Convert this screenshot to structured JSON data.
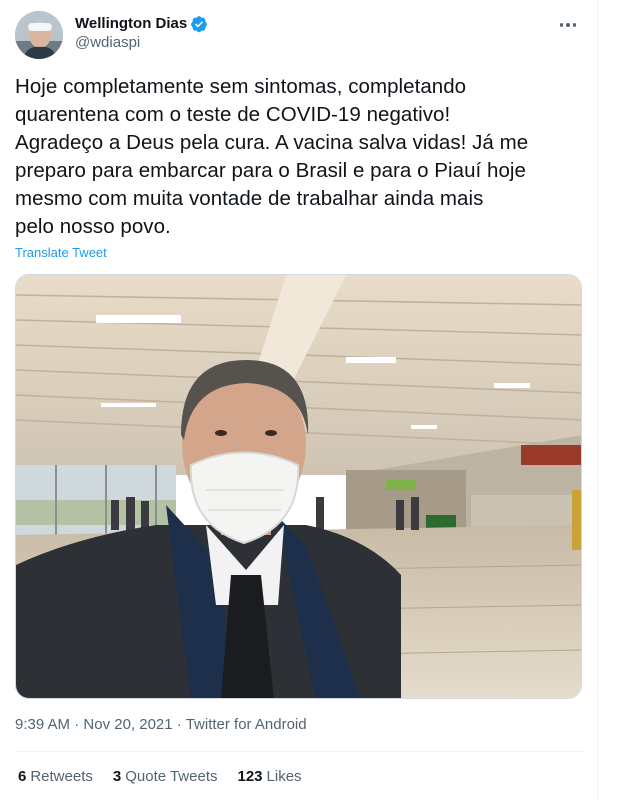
{
  "author": {
    "display_name": "Wellington Dias",
    "handle": "@wdiaspi",
    "verified": true
  },
  "tweet": {
    "text": "Hoje completamente sem sintomas, completando\nquarentena com o teste de COVID-19 negativo!\nAgradeço a Deus pela cura. A vacina salva vidas! Já me\npreparo para embarcar para o Brasil e para o Piauí hoje\nmesmo com muita vontade de trabalhar ainda mais\npelo nosso povo.",
    "translate_label": "Translate Tweet",
    "time": "9:39 AM",
    "separator": "·",
    "date": "Nov 20, 2021",
    "source": "Twitter for Android"
  },
  "stats": {
    "retweets_count": "6",
    "retweets_label": "Retweets",
    "quotes_count": "3",
    "quotes_label": "Quote Tweets",
    "likes_count": "123",
    "likes_label": "Likes"
  },
  "colors": {
    "accent": "#1d9bf0",
    "secondary_text": "#536471",
    "primary_text": "#0f1419"
  }
}
